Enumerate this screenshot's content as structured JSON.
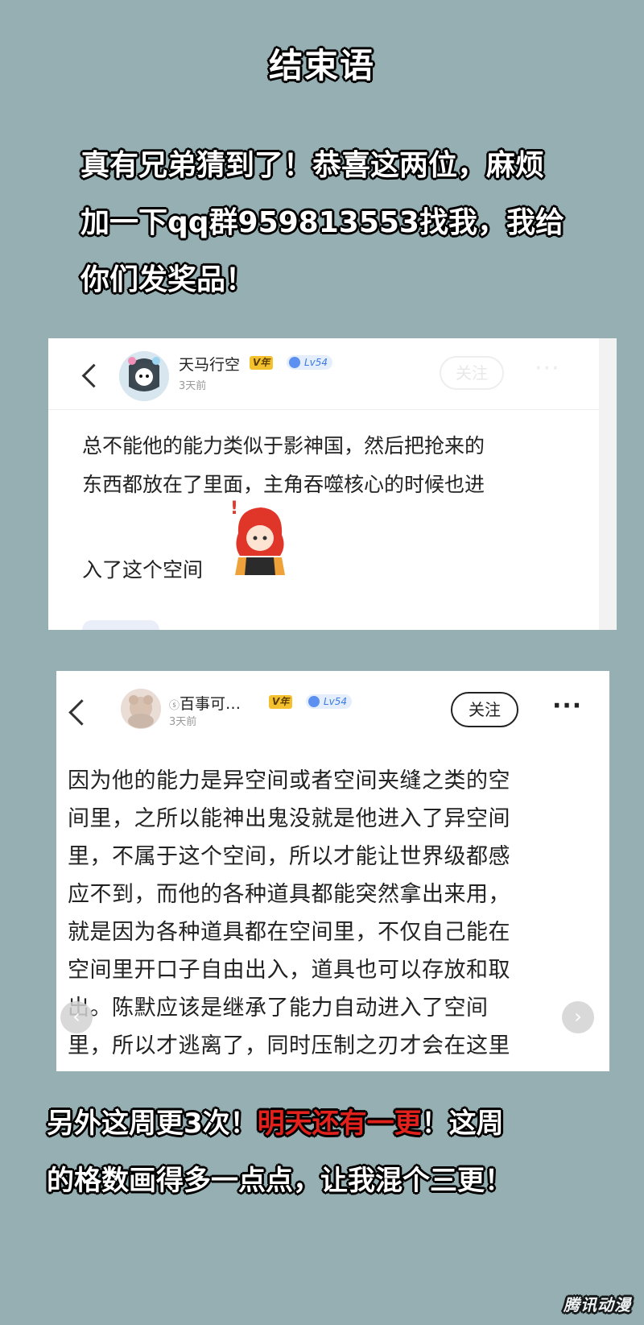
{
  "title": "结束语",
  "intro": {
    "line1": "真有兄弟猜到了！恭喜这两位，麻烦",
    "line2": "加一下qq群959813553找我，我给",
    "line3": "你们发奖品！"
  },
  "card1": {
    "username": "天马行空",
    "time": "3天前",
    "vip_badge": "V年",
    "level_badge": "Lv54",
    "follow_label": "关注",
    "more_label": "···",
    "line1": "总不能他的能力类似于影神国，然后把抢来的",
    "line2": "东西都放在了里面，主角吞噬核心的时候也进",
    "line3": "入了这个空间"
  },
  "card2": {
    "username": "百事可…",
    "username_prefix": "ⓢ",
    "time": "3天前",
    "vip_badge": "V年",
    "level_badge": "Lv54",
    "follow_label": "关注",
    "more_label": "···",
    "lines": [
      "因为他的能力是异空间或者空间夹缝之类的空",
      "间里，之所以能神出鬼没就是他进入了异空间",
      "里，不属于这个空间，所以才能让世界级都感",
      "应不到，而他的各种道具都能突然拿出来用，",
      "就是因为各种道具都在空间里，不仅自己能在",
      "空间里开口子自由出入，道具也可以存放和取",
      "出。陈默应该是继承了能力自动进入了空间",
      "里，所以才逃离了，同时压制之刃才会在这里"
    ]
  },
  "outro": {
    "part1": "另外这周更3次！",
    "highlight": "明天还有一更",
    "part2": "！这周",
    "line2": "的格数画得多一点点，让我混个三更！"
  },
  "watermark": "腾讯动漫",
  "colors": {
    "background": "#96afb3",
    "highlight": "#e3211c",
    "vip": "#f3c12e",
    "level": "#3d7ae0"
  }
}
